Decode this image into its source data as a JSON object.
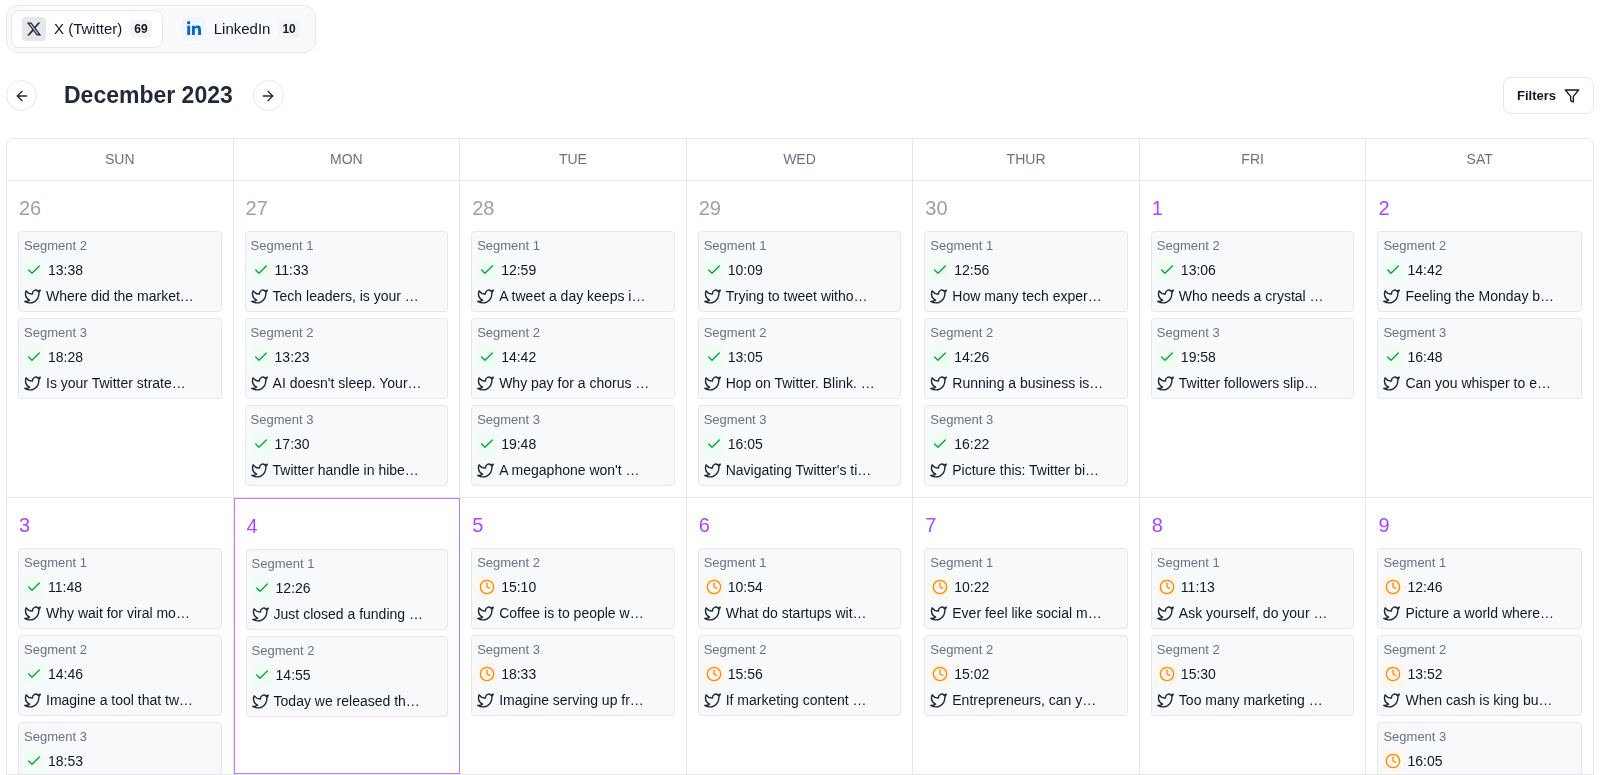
{
  "channels": [
    {
      "kind": "x",
      "label": "X (Twitter)",
      "count": "69",
      "selected": true
    },
    {
      "kind": "linkedin",
      "label": "LinkedIn",
      "count": "10",
      "selected": false
    }
  ],
  "header": {
    "month": "December 2023",
    "filters_button": "Filters"
  },
  "weekdays": [
    "SUN",
    "MON",
    "TUE",
    "WED",
    "THUR",
    "FRI",
    "SAT"
  ],
  "weeks": [
    [
      {
        "day": "26",
        "current_month": false,
        "selected": false,
        "posts": [
          {
            "segment": "Segment 2",
            "posted": true,
            "time": "13:38",
            "text": "Where did the market…"
          },
          {
            "segment": "Segment 3",
            "posted": true,
            "time": "18:28",
            "text": "Is your Twitter strate…"
          }
        ]
      },
      {
        "day": "27",
        "current_month": false,
        "selected": false,
        "posts": [
          {
            "segment": "Segment 1",
            "posted": true,
            "time": "11:33",
            "text": "Tech leaders, is your …"
          },
          {
            "segment": "Segment 2",
            "posted": true,
            "time": "13:23",
            "text": "AI doesn't sleep. Your…"
          },
          {
            "segment": "Segment 3",
            "posted": true,
            "time": "17:30",
            "text": "Twitter handle in hibe…"
          }
        ]
      },
      {
        "day": "28",
        "current_month": false,
        "selected": false,
        "posts": [
          {
            "segment": "Segment 1",
            "posted": true,
            "time": "12:59",
            "text": "A tweet a day keeps i…"
          },
          {
            "segment": "Segment 2",
            "posted": true,
            "time": "14:42",
            "text": "Why pay for a chorus …"
          },
          {
            "segment": "Segment 3",
            "posted": true,
            "time": "19:48",
            "text": "A megaphone won't …"
          }
        ]
      },
      {
        "day": "29",
        "current_month": false,
        "selected": false,
        "posts": [
          {
            "segment": "Segment 1",
            "posted": true,
            "time": "10:09",
            "text": "Trying to tweet witho…"
          },
          {
            "segment": "Segment 2",
            "posted": true,
            "time": "13:05",
            "text": "Hop on Twitter. Blink. …"
          },
          {
            "segment": "Segment 3",
            "posted": true,
            "time": "16:05",
            "text": "Navigating Twitter's ti…"
          }
        ]
      },
      {
        "day": "30",
        "current_month": false,
        "selected": false,
        "posts": [
          {
            "segment": "Segment 1",
            "posted": true,
            "time": "12:56",
            "text": "How many tech exper…"
          },
          {
            "segment": "Segment 2",
            "posted": true,
            "time": "14:26",
            "text": "Running a business is…"
          },
          {
            "segment": "Segment 3",
            "posted": true,
            "time": "16:22",
            "text": "Picture this: Twitter bi…"
          }
        ]
      },
      {
        "day": "1",
        "current_month": true,
        "selected": false,
        "posts": [
          {
            "segment": "Segment 2",
            "posted": true,
            "time": "13:06",
            "text": "Who needs a crystal …"
          },
          {
            "segment": "Segment 3",
            "posted": true,
            "time": "19:58",
            "text": "Twitter followers slip…"
          }
        ]
      },
      {
        "day": "2",
        "current_month": true,
        "selected": false,
        "posts": [
          {
            "segment": "Segment 2",
            "posted": true,
            "time": "14:42",
            "text": "Feeling the Monday b…"
          },
          {
            "segment": "Segment 3",
            "posted": true,
            "time": "16:48",
            "text": "Can you whisper to e…"
          }
        ]
      }
    ],
    [
      {
        "day": "3",
        "current_month": true,
        "selected": false,
        "posts": [
          {
            "segment": "Segment 1",
            "posted": true,
            "time": "11:48",
            "text": "Why wait for viral mo…"
          },
          {
            "segment": "Segment 2",
            "posted": true,
            "time": "14:46",
            "text": "Imagine a tool that tw…"
          },
          {
            "segment": "Segment 3",
            "posted": true,
            "time": "18:53"
          }
        ]
      },
      {
        "day": "4",
        "current_month": true,
        "selected": true,
        "posts": [
          {
            "segment": "Segment 1",
            "posted": true,
            "time": "12:26",
            "text": "Just closed a funding …"
          },
          {
            "segment": "Segment 2",
            "posted": true,
            "time": "14:55",
            "text": "Today we released th…"
          }
        ]
      },
      {
        "day": "5",
        "current_month": true,
        "selected": false,
        "posts": [
          {
            "segment": "Segment 2",
            "posted": false,
            "time": "15:10",
            "text": "Coffee is to people w…"
          },
          {
            "segment": "Segment 3",
            "posted": false,
            "time": "18:33",
            "text": "Imagine serving up fr…"
          }
        ]
      },
      {
        "day": "6",
        "current_month": true,
        "selected": false,
        "posts": [
          {
            "segment": "Segment 1",
            "posted": false,
            "time": "10:54",
            "text": "What do startups wit…"
          },
          {
            "segment": "Segment 2",
            "posted": false,
            "time": "15:56",
            "text": "If marketing content …"
          }
        ]
      },
      {
        "day": "7",
        "current_month": true,
        "selected": false,
        "posts": [
          {
            "segment": "Segment 1",
            "posted": false,
            "time": "10:22",
            "text": "Ever feel like social m…"
          },
          {
            "segment": "Segment 2",
            "posted": false,
            "time": "15:02",
            "text": "Entrepreneurs, can y…"
          }
        ]
      },
      {
        "day": "8",
        "current_month": true,
        "selected": false,
        "posts": [
          {
            "segment": "Segment 1",
            "posted": false,
            "time": "11:13",
            "text": "Ask yourself, do your …"
          },
          {
            "segment": "Segment 2",
            "posted": false,
            "time": "15:30",
            "text": "Too many marketing …"
          }
        ]
      },
      {
        "day": "9",
        "current_month": true,
        "selected": false,
        "posts": [
          {
            "segment": "Segment 1",
            "posted": false,
            "time": "12:46",
            "text": "Picture a world where…"
          },
          {
            "segment": "Segment 2",
            "posted": false,
            "time": "13:52",
            "text": "When cash is king bu…"
          },
          {
            "segment": "Segment 3",
            "posted": false,
            "time": "16:05"
          }
        ]
      }
    ]
  ]
}
